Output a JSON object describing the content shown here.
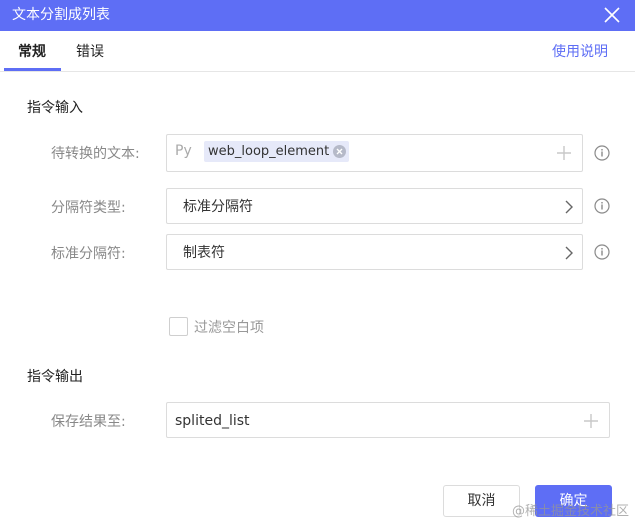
{
  "dialog": {
    "title": "文本分割成列表"
  },
  "tabs": [
    {
      "label": "常规",
      "active": true
    },
    {
      "label": "错误",
      "active": false
    }
  ],
  "help_link": "使用说明",
  "input_section": {
    "title": "指令输入",
    "text_to_convert": {
      "label": "待转换的文本:",
      "prefix": "Py",
      "chip": "web_loop_element"
    },
    "separator_type": {
      "label": "分隔符类型:",
      "value": "标准分隔符"
    },
    "standard_separator": {
      "label": "标准分隔符:",
      "value": "制表符"
    },
    "filter_empty": {
      "label": "过滤空白项",
      "checked": false
    }
  },
  "output_section": {
    "title": "指令输出",
    "save_to": {
      "label": "保存结果至:",
      "value": "splited_list"
    }
  },
  "buttons": {
    "cancel": "取消",
    "ok": "确定"
  },
  "watermark": "@稀土掘金技术社区",
  "colors": {
    "accent": "#5e6ef5",
    "chip_bg": "#e6e9f9",
    "border": "#dcdcdc",
    "label": "#888888"
  },
  "icons": [
    "close-icon",
    "info-icon",
    "chevron-right-icon",
    "plus-icon",
    "clear-chip-icon"
  ]
}
